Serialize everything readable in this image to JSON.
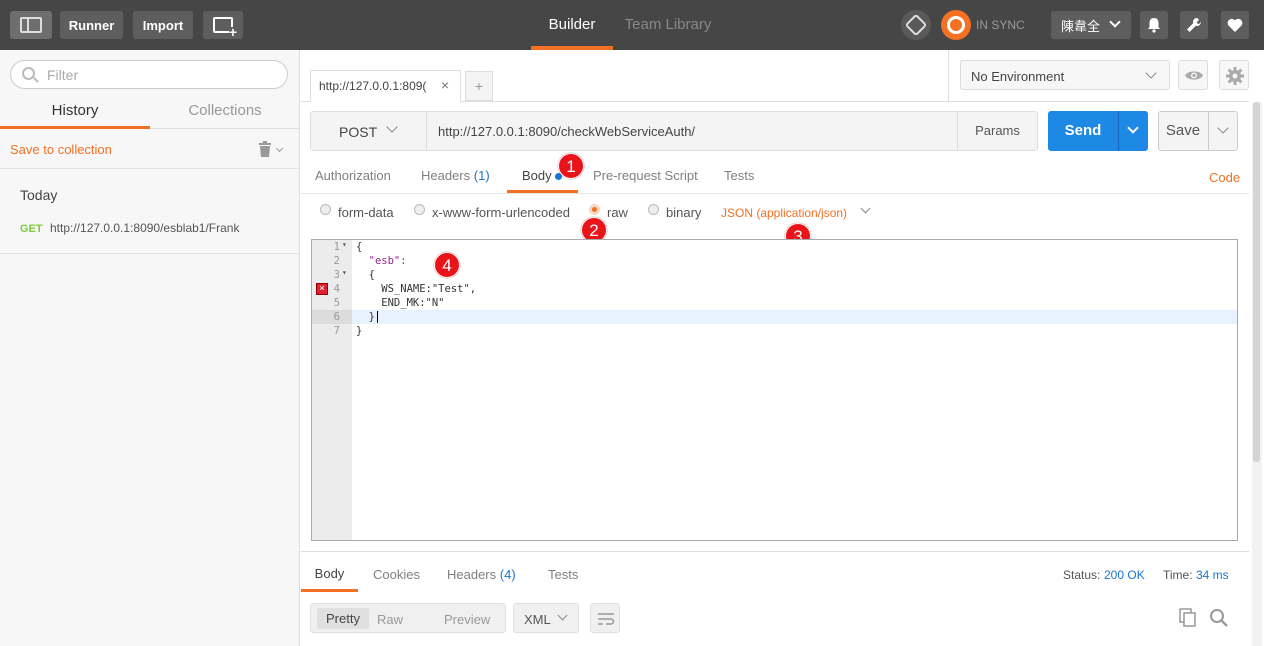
{
  "topbar": {
    "runner": "Runner",
    "import": "Import",
    "builder": "Builder",
    "team_library": "Team Library",
    "sync": "IN SYNC",
    "user": "陳韋全"
  },
  "sidebar": {
    "filter_placeholder": "Filter",
    "tab_history": "History",
    "tab_collections": "Collections",
    "save_to_collection": "Save to collection",
    "group_today": "Today",
    "history_items": [
      {
        "method": "GET",
        "url": "http://127.0.0.1:8090/esblab1/Frank"
      }
    ]
  },
  "request_tab": {
    "label": "http://127.0.0.1:809(",
    "add": "+"
  },
  "environment": {
    "selected": "No Environment"
  },
  "request": {
    "method": "POST",
    "url": "http://127.0.0.1:8090/checkWebServiceAuth/",
    "params": "Params",
    "send": "Send",
    "save": "Save"
  },
  "req_tabs": {
    "authorization": "Authorization",
    "headers": "Headers",
    "headers_count": "(1)",
    "body": "Body",
    "prerequest": "Pre-request Script",
    "tests": "Tests",
    "code": "Code"
  },
  "body_modes": {
    "form_data": "form-data",
    "urlencoded": "x-www-form-urlencoded",
    "raw": "raw",
    "binary": "binary",
    "content_type": "JSON (application/json)"
  },
  "badges": [
    "1",
    "2",
    "3",
    "4"
  ],
  "editor": {
    "lines": [
      {
        "num": "1",
        "text": "{"
      },
      {
        "num": "2",
        "text": "  \"esb\":"
      },
      {
        "num": "3",
        "text": "  {"
      },
      {
        "num": "4",
        "text": "    WS_NAME:\"Test\","
      },
      {
        "num": "5",
        "text": "    END_MK:\"N\""
      },
      {
        "num": "6",
        "text": "  }"
      },
      {
        "num": "7",
        "text": "}"
      }
    ]
  },
  "response": {
    "tab_body": "Body",
    "tab_cookies": "Cookies",
    "tab_headers": "Headers",
    "headers_count": "(4)",
    "tab_tests": "Tests",
    "status_label": "Status:",
    "status_value": "200 OK",
    "time_label": "Time:",
    "time_value": "34 ms",
    "view_pretty": "Pretty",
    "view_raw": "Raw",
    "view_preview": "Preview",
    "format": "XML"
  },
  "colors": {
    "accent": "#f47023",
    "send_blue": "#1e88e5",
    "link_blue": "#1976d2",
    "get_green": "#80c83c",
    "topbar": "#464646",
    "badge_red": "#e8141a"
  }
}
